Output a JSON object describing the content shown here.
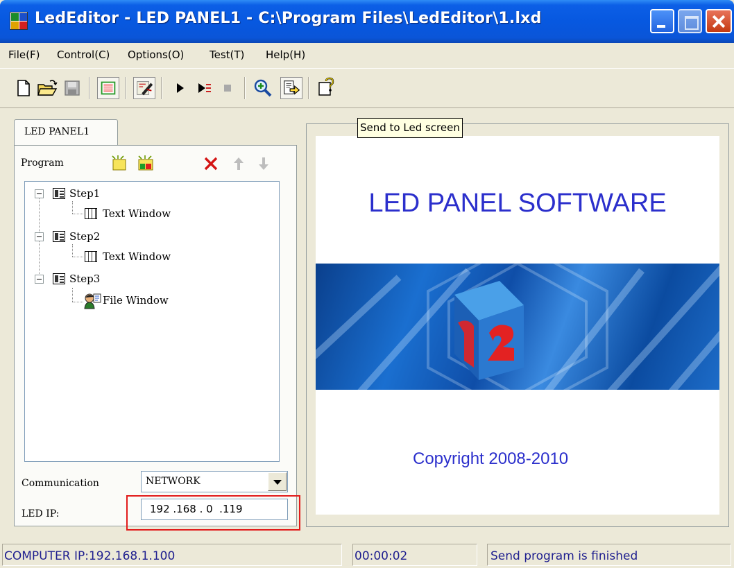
{
  "window": {
    "title": "LedEditor - LED PANEL1 - C:\\Program Files\\LedEditor\\1.lxd"
  },
  "menu": [
    {
      "label": "File(F)"
    },
    {
      "label": "Control(C)"
    },
    {
      "label": "Options(O)"
    },
    {
      "label": "Test(T)"
    },
    {
      "label": "Help(H)"
    }
  ],
  "toolbar": {
    "icons": [
      "new-file-icon",
      "open-folder-icon",
      "save-icon",
      "grid-icon",
      "edit-pen-icon",
      "play-icon",
      "step-play-icon",
      "stop-icon",
      "zoom-icon",
      "send-icon",
      "help-icon"
    ],
    "tooltip": "Send to Led screen"
  },
  "panel": {
    "tab": "LED PANEL1",
    "program_label": "Program",
    "tree": [
      {
        "label": "Step1",
        "children": [
          {
            "label": "Text Window"
          }
        ]
      },
      {
        "label": "Step2",
        "children": [
          {
            "label": "Text Window"
          }
        ]
      },
      {
        "label": "Step3",
        "children": [
          {
            "label": "File Window"
          }
        ]
      }
    ],
    "communication_label": "Communication",
    "communication_value": "NETWORK",
    "ip_label": "LED IP:",
    "ip_value": "192 .168 . 0  .119"
  },
  "preview": {
    "title": "LED PANEL SOFTWARE",
    "copyright": "Copyright 2008-2010"
  },
  "status": {
    "computer_ip": "COMPUTER IP:192.168.1.100",
    "elapsed": "00:00:02",
    "message": "Send program is finished"
  }
}
